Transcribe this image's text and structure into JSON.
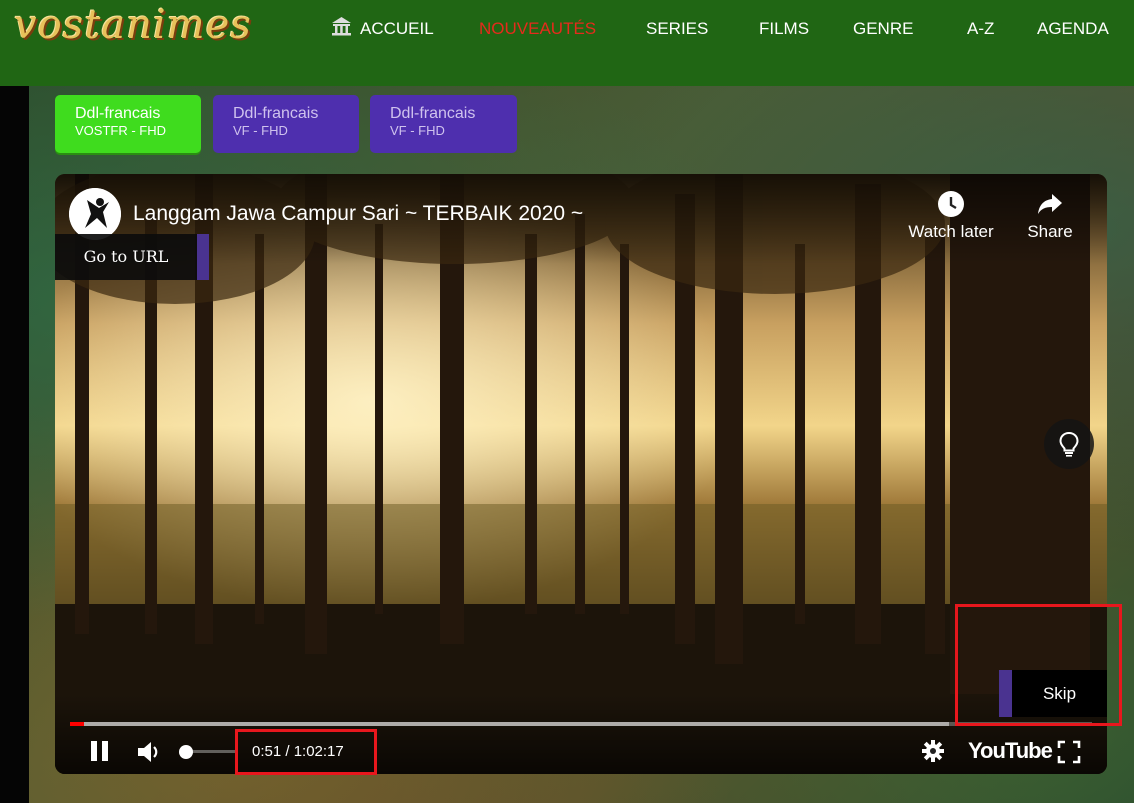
{
  "header": {
    "logo": "vostanimes",
    "nav": [
      {
        "label": "ACCUEIL",
        "active": false,
        "icon": "home-icon"
      },
      {
        "label": "NOUVEAUTÉS",
        "active": true
      },
      {
        "label": "SERIES",
        "active": false
      },
      {
        "label": "FILMS",
        "active": false
      },
      {
        "label": "GENRE",
        "active": false
      },
      {
        "label": "A-Z",
        "active": false
      },
      {
        "label": "AGENDA",
        "active": false
      }
    ]
  },
  "ddl_buttons": [
    {
      "title": "Ddl-francais",
      "subtitle": "VOSTFR - FHD",
      "color": "#3fdc1e",
      "active": true
    },
    {
      "title": "Ddl-francais",
      "subtitle": "VF - FHD",
      "color": "#4e2fae",
      "active": false
    },
    {
      "title": "Ddl-francais",
      "subtitle": "VF - FHD",
      "color": "#4e2fae",
      "active": false
    }
  ],
  "player": {
    "title": "Langgam Jawa Campur Sari ~ TERBAIK 2020 ~",
    "watch_later": "Watch later",
    "share": "Share",
    "goto_url": "Go to URL",
    "skip": "Skip",
    "time": "0:51 / 1:02:17",
    "progress_fraction": 0.0137,
    "logo": "YouTube",
    "colors": {
      "progress": "#ff0000",
      "ad_accent": "#4a3390",
      "highlight": "#e8171d"
    }
  }
}
